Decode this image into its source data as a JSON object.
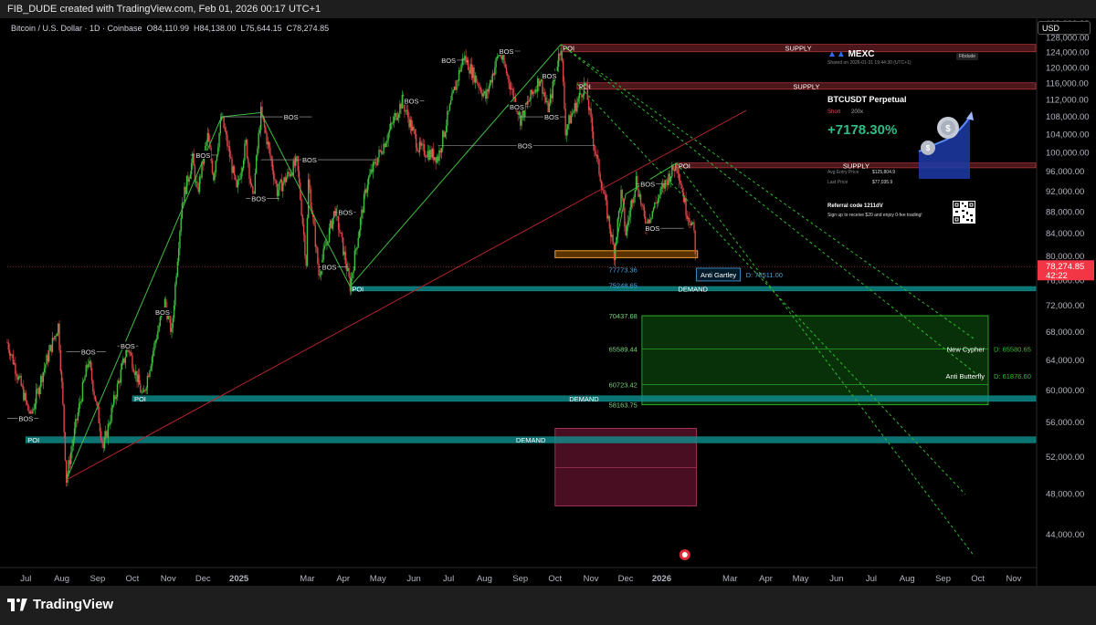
{
  "header": {
    "title": "FIB_DUDE created with TradingView.com, Feb 01, 2026 00:17 UTC+1"
  },
  "symbol": {
    "name": "Bitcoin / U.S. Dollar · 1D · Coinbase",
    "o_label": "O",
    "o": "84,110.99",
    "h_label": "H",
    "h": "84,138.00",
    "l_label": "L",
    "l": "75,644.15",
    "c_label": "C",
    "c": "78,274.85"
  },
  "currency_label": "USD",
  "brand": "TradingView",
  "mexc_card": {
    "brand": "MEXC",
    "shared": "Shared on 2026-01-31 19:44:30 (UTC+1)",
    "user": "Fibdude",
    "pair": "BTCUSDT Perpetual",
    "side": "Short",
    "leverage": "200x",
    "pnl": "+7178.30%",
    "entry_label": "Avg Entry Price",
    "entry_value": "$125,804.9",
    "last_label": "Last Price",
    "last_value": "$77,035.9",
    "referral": "Referral code  1211dV",
    "referral_desc": "Sign up to receive $20 and enjoy 0-fee trading!"
  },
  "colors": {
    "up": "#26a69a",
    "down": "#ef5350",
    "supply": "#d9414b",
    "demand": "#0f9090",
    "trend_green": "#3fbf3f",
    "trend_red": "#b2242b",
    "fib_green": "#2dbb2d"
  },
  "chart_data": {
    "type": "candlestick",
    "y_scale": "log",
    "ylim": [
      41000,
      133500
    ],
    "y_ticks": [
      44000,
      48000,
      52000,
      56000,
      60000,
      64000,
      68000,
      72000,
      76000,
      80000,
      84000,
      88000,
      92000,
      96000,
      100000,
      104000,
      108000,
      112000,
      116000,
      120000,
      124000,
      128000,
      132000
    ],
    "y_tick_labels": [
      "44,000.00",
      "48,000.00",
      "52,000.00",
      "56,000.00",
      "60,000.00",
      "64,000.00",
      "68,000.00",
      "72,000.00",
      "76,000.00",
      "80,000.00",
      "84,000.00",
      "88,000.00",
      "92,000.00",
      "96,000.00",
      "100,000.00",
      "104,000.00",
      "108,000.00",
      "112,000.00",
      "116,000.00",
      "120,000.00",
      "124,000.00",
      "128,000.00",
      "132,000.00"
    ],
    "xlim": [
      "2024-06-15",
      "2026-11-20"
    ],
    "x_ticks": [
      {
        "date": "2024-07-01",
        "label": "Jul",
        "bold": false
      },
      {
        "date": "2024-08-01",
        "label": "Aug",
        "bold": false
      },
      {
        "date": "2024-09-01",
        "label": "Sep",
        "bold": false
      },
      {
        "date": "2024-10-01",
        "label": "Oct",
        "bold": false
      },
      {
        "date": "2024-11-01",
        "label": "Nov",
        "bold": false
      },
      {
        "date": "2024-12-01",
        "label": "Dec",
        "bold": false
      },
      {
        "date": "2025-01-01",
        "label": "2025",
        "bold": true
      },
      {
        "date": "2025-03-01",
        "label": "Mar",
        "bold": false
      },
      {
        "date": "2025-04-01",
        "label": "Apr",
        "bold": false
      },
      {
        "date": "2025-05-01",
        "label": "May",
        "bold": false
      },
      {
        "date": "2025-06-01",
        "label": "Jun",
        "bold": false
      },
      {
        "date": "2025-07-01",
        "label": "Jul",
        "bold": false
      },
      {
        "date": "2025-08-01",
        "label": "Aug",
        "bold": false
      },
      {
        "date": "2025-09-01",
        "label": "Sep",
        "bold": false
      },
      {
        "date": "2025-10-01",
        "label": "Oct",
        "bold": false
      },
      {
        "date": "2025-11-01",
        "label": "Nov",
        "bold": false
      },
      {
        "date": "2025-12-01",
        "label": "Dec",
        "bold": false
      },
      {
        "date": "2026-01-01",
        "label": "2026",
        "bold": true
      },
      {
        "date": "2026-03-01",
        "label": "Mar",
        "bold": false
      },
      {
        "date": "2026-04-01",
        "label": "Apr",
        "bold": false
      },
      {
        "date": "2026-05-01",
        "label": "May",
        "bold": false
      },
      {
        "date": "2026-06-01",
        "label": "Jun",
        "bold": false
      },
      {
        "date": "2026-07-01",
        "label": "Jul",
        "bold": false
      },
      {
        "date": "2026-08-01",
        "label": "Aug",
        "bold": false
      },
      {
        "date": "2026-09-01",
        "label": "Sep",
        "bold": false
      },
      {
        "date": "2026-10-01",
        "label": "Oct",
        "bold": false
      },
      {
        "date": "2026-11-01",
        "label": "Nov",
        "bold": false
      }
    ],
    "price_path": [
      [
        "2024-06-15",
        66500
      ],
      [
        "2024-07-05",
        56500
      ],
      [
        "2024-07-15",
        62000
      ],
      [
        "2024-07-29",
        69000
      ],
      [
        "2024-08-05",
        49500
      ],
      [
        "2024-08-24",
        64000
      ],
      [
        "2024-09-06",
        53000
      ],
      [
        "2024-09-27",
        66000
      ],
      [
        "2024-10-10",
        59000
      ],
      [
        "2024-10-29",
        72500
      ],
      [
        "2024-11-04",
        67800
      ],
      [
        "2024-11-13",
        90000
      ],
      [
        "2024-11-22",
        98500
      ],
      [
        "2024-11-26",
        91500
      ],
      [
        "2024-12-05",
        103500
      ],
      [
        "2024-12-10",
        95000
      ],
      [
        "2024-12-17",
        108000
      ],
      [
        "2024-12-30",
        92000
      ],
      [
        "2025-01-07",
        102000
      ],
      [
        "2025-01-13",
        90000
      ],
      [
        "2025-01-20",
        109000
      ],
      [
        "2025-02-03",
        92000
      ],
      [
        "2025-02-20",
        98000
      ],
      [
        "2025-02-28",
        79000
      ],
      [
        "2025-03-02",
        94000
      ],
      [
        "2025-03-11",
        77000
      ],
      [
        "2025-03-25",
        88500
      ],
      [
        "2025-04-07",
        75000
      ],
      [
        "2025-04-22",
        94000
      ],
      [
        "2025-05-08",
        103000
      ],
      [
        "2025-05-22",
        111800
      ],
      [
        "2025-06-05",
        101000
      ],
      [
        "2025-06-22",
        99000
      ],
      [
        "2025-07-14",
        123000
      ],
      [
        "2025-08-02",
        112500
      ],
      [
        "2025-08-14",
        124400
      ],
      [
        "2025-09-01",
        107500
      ],
      [
        "2025-09-18",
        117500
      ],
      [
        "2025-09-25",
        109000
      ],
      [
        "2025-10-06",
        126200
      ],
      [
        "2025-10-10",
        105000
      ],
      [
        "2025-10-27",
        116000
      ],
      [
        "2025-11-04",
        101000
      ],
      [
        "2025-11-21",
        80600
      ],
      [
        "2025-11-27",
        91500
      ],
      [
        "2025-12-01",
        84000
      ],
      [
        "2025-12-10",
        94500
      ],
      [
        "2025-12-18",
        85500
      ],
      [
        "2026-01-06",
        94500
      ],
      [
        "2026-01-14",
        97800
      ],
      [
        "2026-01-22",
        88500
      ],
      [
        "2026-01-26",
        86500
      ],
      [
        "2026-01-29",
        84100
      ],
      [
        "2026-01-31",
        78274
      ]
    ],
    "last_price": {
      "value": 78274.85,
      "label": "78,274.85",
      "countdown": "42:22"
    },
    "zones": [
      {
        "kind": "supply",
        "label": "SUPPLY",
        "poi": "POI",
        "x1": "2025-10-06",
        "low": 124200,
        "high": 126200
      },
      {
        "kind": "supply",
        "label": "SUPPLY",
        "poi": "POI",
        "x1": "2025-10-20",
        "low": 114600,
        "high": 116200
      },
      {
        "kind": "supply",
        "label": "SUPPLY",
        "poi": "POI",
        "x1": "2026-01-14",
        "low": 96800,
        "high": 97800
      },
      {
        "kind": "demand",
        "label": "DEMAND",
        "poi": "POI",
        "x1": "2025-04-07",
        "low": 74300,
        "high": 75000
      },
      {
        "kind": "demand",
        "label": "DEMAND",
        "poi": "POI",
        "x1": "2024-10-01",
        "low": 58600,
        "high": 59300
      },
      {
        "kind": "demand",
        "label": "DEMAND",
        "poi": "POI",
        "x1": "2024-07-01",
        "low": 53600,
        "high": 54300
      }
    ],
    "bos_marks": [
      {
        "date": "2025-02-15",
        "price": 108000,
        "label": "BOS",
        "x1": "2024-12-17",
        "x2": "2025-03-05"
      },
      {
        "date": "2024-12-01",
        "price": 99500,
        "label": "BOS",
        "x1": "2024-11-20",
        "x2": "2024-12-12"
      },
      {
        "date": "2025-03-03",
        "price": 98500,
        "label": "BOS",
        "x1": "2025-01-20",
        "x2": "2025-04-30"
      },
      {
        "date": "2025-01-18",
        "price": 90600,
        "label": "BOS",
        "x1": "2025-01-07",
        "x2": "2025-02-05"
      },
      {
        "date": "2025-04-03",
        "price": 88000,
        "label": "BOS",
        "x1": "2025-03-25",
        "x2": "2025-04-12"
      },
      {
        "date": "2025-03-20",
        "price": 78200,
        "label": "BOS",
        "x1": "2025-03-11",
        "x2": "2025-04-05"
      },
      {
        "date": "2024-10-27",
        "price": 71000,
        "label": "BOS",
        "x1": "2024-10-21",
        "x2": "2024-11-04"
      },
      {
        "date": "2024-09-27",
        "price": 66000,
        "label": "BOS",
        "x1": "2024-09-18",
        "x2": "2024-10-06"
      },
      {
        "date": "2024-08-24",
        "price": 65200,
        "label": "BOS",
        "x1": "2024-08-05",
        "x2": "2024-09-08"
      },
      {
        "date": "2024-07-01",
        "price": 56500,
        "label": "BOS",
        "x1": "2024-06-15",
        "x2": "2024-07-12"
      },
      {
        "date": "2025-05-30",
        "price": 111800,
        "label": "BOS",
        "x1": "2025-05-22",
        "x2": "2025-06-10"
      },
      {
        "date": "2025-07-01",
        "price": 122000,
        "label": "BOS",
        "x1": "2025-06-25",
        "x2": "2025-07-15"
      },
      {
        "date": "2025-08-20",
        "price": 124400,
        "label": "BOS",
        "x1": "2025-08-14",
        "x2": "2025-09-01"
      },
      {
        "date": "2025-08-29",
        "price": 110400,
        "label": "BOS",
        "x1": "2025-08-20",
        "x2": "2025-09-10"
      },
      {
        "date": "2025-09-26",
        "price": 118000,
        "label": "BOS",
        "x1": "2025-09-20",
        "x2": "2025-10-02"
      },
      {
        "date": "2025-09-28",
        "price": 108000,
        "label": "BOS",
        "x1": "2025-09-01",
        "x2": "2025-10-10"
      },
      {
        "date": "2025-09-05",
        "price": 101500,
        "label": "BOS",
        "x1": "2025-06-22",
        "x2": "2025-11-04"
      },
      {
        "date": "2025-12-20",
        "price": 93500,
        "label": "BOS",
        "x1": "2025-12-10",
        "x2": "2026-01-05"
      },
      {
        "date": "2025-12-24",
        "price": 85000,
        "label": "BOS",
        "x1": "2025-12-18",
        "x2": "2026-01-20"
      }
    ],
    "trendlines": [
      {
        "color": "green",
        "points": [
          [
            "2024-08-05",
            49500
          ],
          [
            "2024-12-17",
            108000
          ],
          [
            "2025-01-20",
            109000
          ],
          [
            "2025-04-07",
            75000
          ],
          [
            "2025-10-06",
            126200
          ]
        ]
      },
      {
        "color": "green",
        "points": [
          [
            "2025-11-21",
            80600
          ],
          [
            "2025-12-01",
            91500
          ],
          [
            "2026-01-14",
            97800
          ]
        ]
      },
      {
        "color": "red",
        "points": [
          [
            "2024-08-05",
            49500
          ],
          [
            "2026-03-15",
            109500
          ]
        ]
      }
    ],
    "projection_lines": [
      {
        "points": [
          [
            "2025-10-06",
            126200
          ],
          [
            "2026-09-28",
            67000
          ]
        ]
      },
      {
        "points": [
          [
            "2025-10-06",
            126200
          ],
          [
            "2026-10-01",
            62000
          ]
        ]
      },
      {
        "points": [
          [
            "2025-10-20",
            116000
          ],
          [
            "2026-09-20",
            48000
          ]
        ]
      },
      {
        "points": [
          [
            "2026-01-14",
            97800
          ],
          [
            "2026-09-28",
            42000
          ]
        ]
      }
    ],
    "harmonic_levels": [
      {
        "price": 77773.36,
        "label": "77773.36"
      },
      {
        "price": 75248.65,
        "label": "75248.65"
      },
      {
        "price": 70437.68,
        "label": "70437.68"
      },
      {
        "price": 65589.44,
        "label": "65589.44"
      },
      {
        "price": 60723.42,
        "label": "60723.42"
      },
      {
        "price": 58163.75,
        "label": "58163.75"
      }
    ],
    "patterns": [
      {
        "name": "Anti Gartley",
        "d_label": "D: 78511.00",
        "price": 76800
      },
      {
        "name": "New Cypher",
        "d_label": "D: 65580.65",
        "price": 65589
      },
      {
        "name": "Anti Butterfly",
        "d_label": "D: 61876.60",
        "price": 61900
      }
    ],
    "target_box": {
      "x1": "2025-12-15",
      "x2": "2026-10-10",
      "low": 58163.75,
      "high": 70437.68
    },
    "pink_box": {
      "x1": "2025-10-01",
      "x2": "2026-01-31",
      "low": 46800,
      "high": 55300,
      "mid": 50800
    },
    "orange_box": {
      "x1": "2025-10-01",
      "x2": "2026-02-01",
      "low": 79800,
      "high": 81000
    }
  }
}
